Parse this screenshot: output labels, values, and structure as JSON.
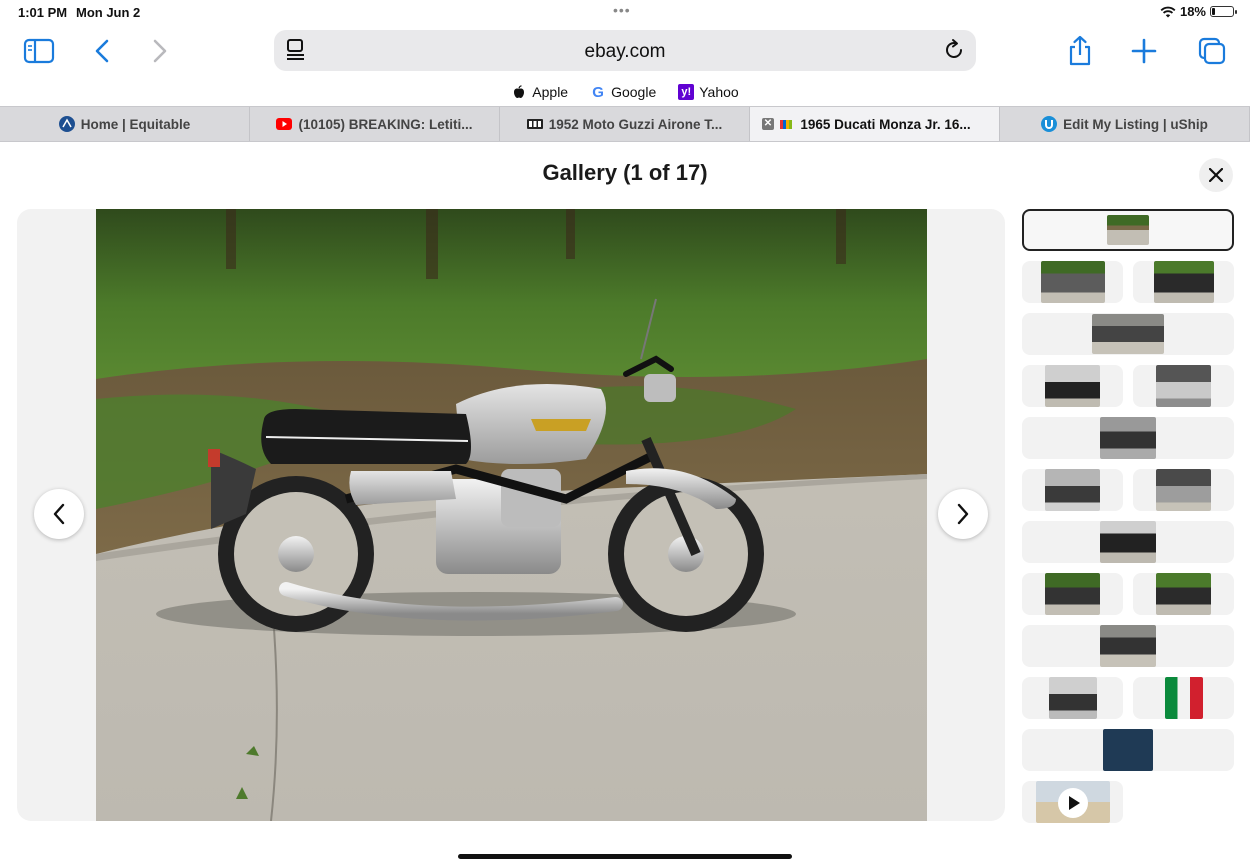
{
  "status_bar": {
    "time": "1:01 PM",
    "date": "Mon Jun 2",
    "battery_text": "18%",
    "battery_level": 0.18
  },
  "toolbar": {
    "url": "ebay.com"
  },
  "favorites": [
    {
      "label": "Apple",
      "icon": "apple-icon"
    },
    {
      "label": "Google",
      "icon": "google-icon"
    },
    {
      "label": "Yahoo",
      "icon": "yahoo-icon"
    }
  ],
  "tabs": [
    {
      "label": "Home | Equitable",
      "icon": "equitable-icon",
      "active": false
    },
    {
      "label": "(10105) BREAKING: Letiti...",
      "icon": "youtube-icon",
      "active": false
    },
    {
      "label": "1952 Moto Guzzi Airone T...",
      "icon": "bat-icon",
      "active": false
    },
    {
      "label": "1965 Ducati Monza Jr. 16...",
      "icon": "ebay-icon",
      "active": true
    },
    {
      "label": "Edit My Listing | uShip",
      "icon": "uship-icon",
      "active": false
    }
  ],
  "gallery": {
    "title": "Gallery (1 of 17)"
  },
  "colors": {
    "accent": "#1a7bdc",
    "tab_bar": "#d9d9dc",
    "stage": "#f2f2f2"
  }
}
